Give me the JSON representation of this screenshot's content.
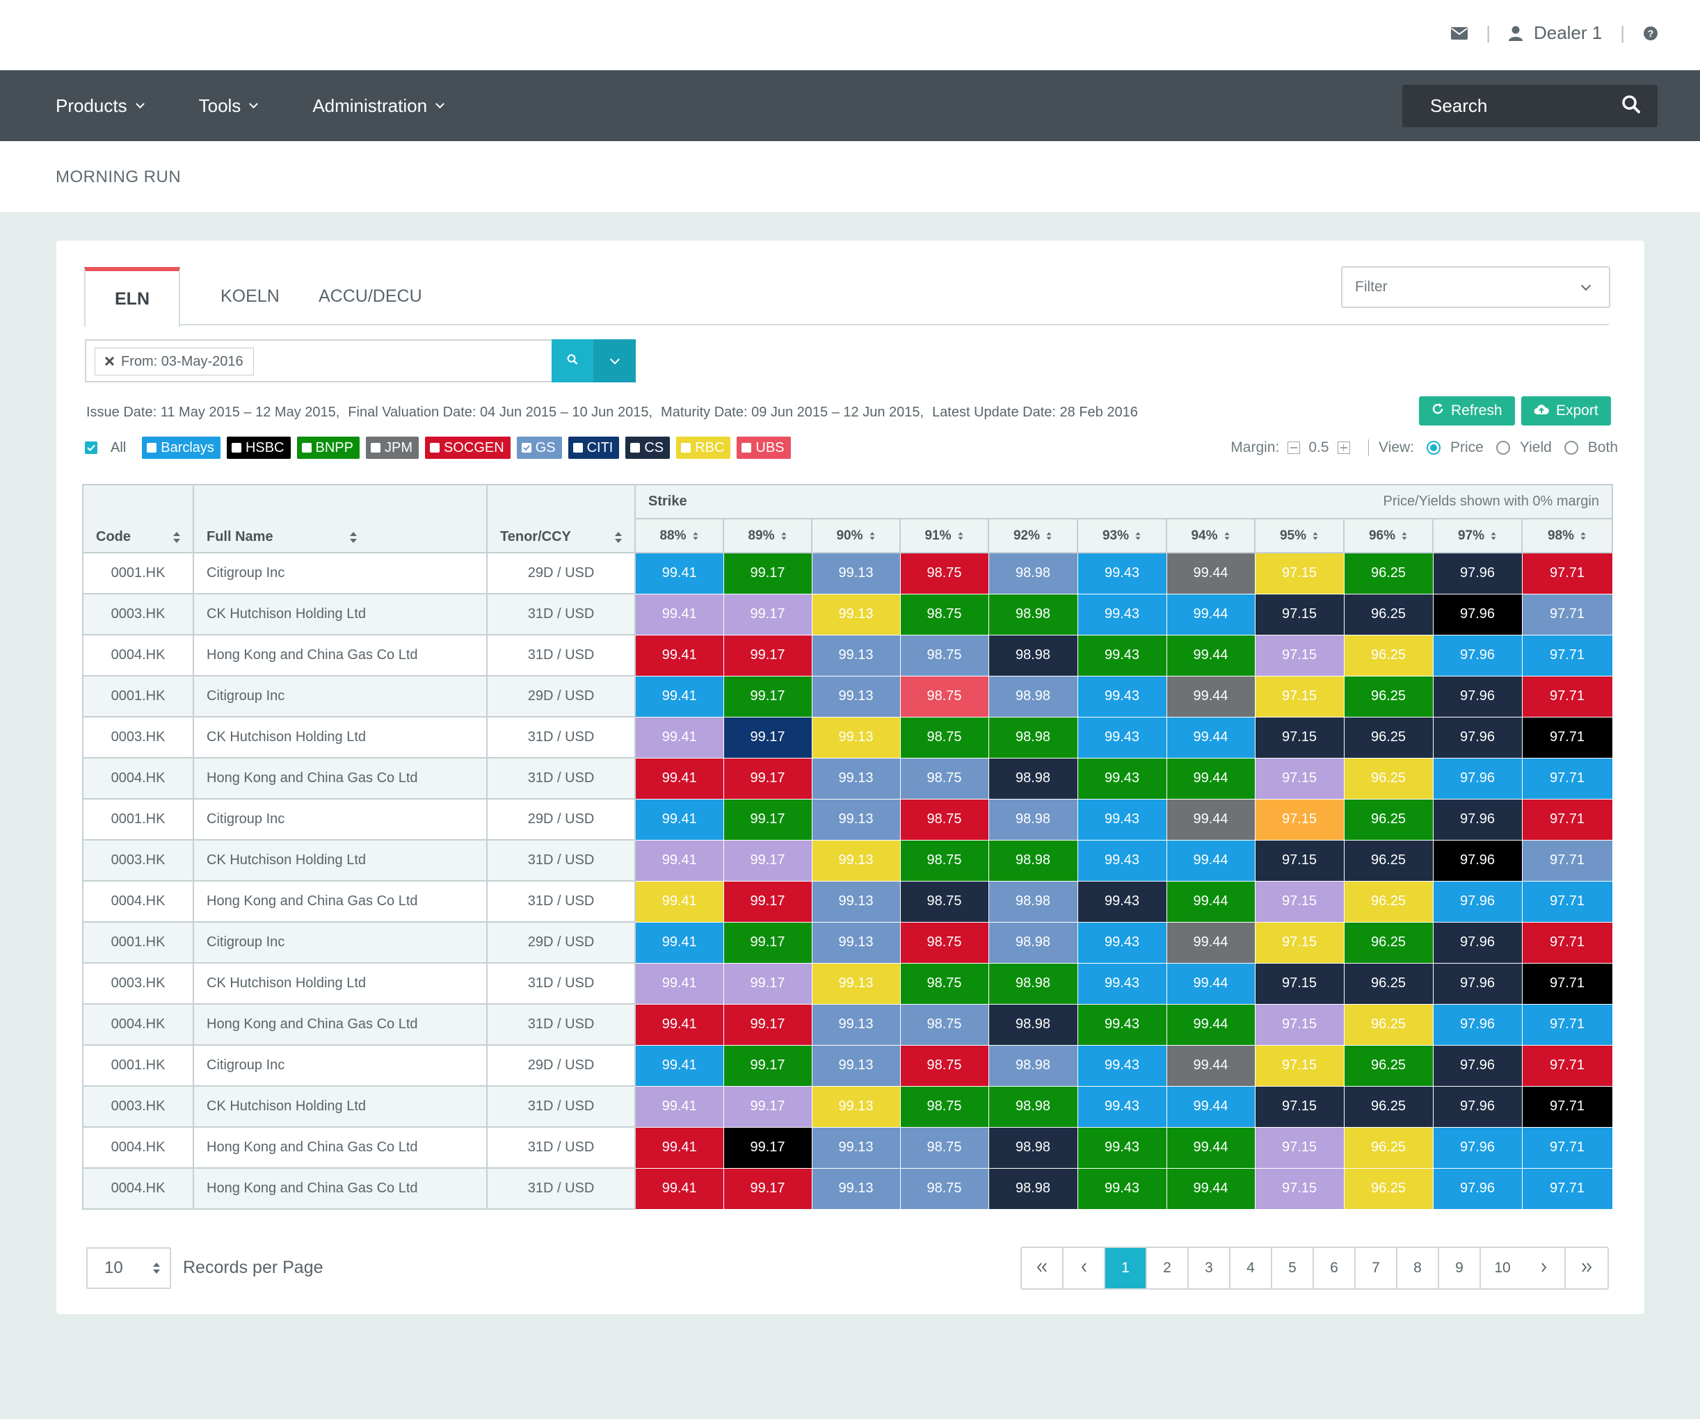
{
  "topbar": {
    "user_name": "Dealer 1",
    "icons": [
      "envelope-icon",
      "user-icon",
      "help-circle-icon"
    ]
  },
  "nav": {
    "menu": [
      {
        "label": "Products"
      },
      {
        "label": "Tools"
      },
      {
        "label": "Administration"
      }
    ],
    "search_placeholder": "Search"
  },
  "page": {
    "title": "MORNING RUN"
  },
  "tabs": [
    "ELN",
    "KOELN",
    "ACCU/DECU"
  ],
  "active_tab": "ELN",
  "filter": {
    "placeholder": "Filter"
  },
  "query": {
    "token": "From: 03-May-2016"
  },
  "dates": [
    "Issue Date: 11 May 2015 – 12 May 2015,",
    "Final Valuation Date: 04 Jun 2015 – 10 Jun 2015,",
    "Maturity Date: 09 Jun 2015 – 12 Jun 2015,",
    "Latest Update Date: 28 Feb 2016"
  ],
  "actions": {
    "refresh": "Refresh",
    "export": "Export"
  },
  "legend": {
    "all_label": "All",
    "banks": [
      {
        "name": "Barclays",
        "color": "#1b9ee3",
        "checked": false
      },
      {
        "name": "HSBC",
        "color": "#000000",
        "checked": false
      },
      {
        "name": "BNPP",
        "color": "#0b8f0b",
        "checked": false
      },
      {
        "name": "JPM",
        "color": "#6e7275",
        "checked": false
      },
      {
        "name": "SOCGEN",
        "color": "#d1102a",
        "checked": false
      },
      {
        "name": "GS",
        "color": "#6e97c8",
        "checked": true
      },
      {
        "name": "CITI",
        "color": "#0e3670",
        "checked": false
      },
      {
        "name": "CS",
        "color": "#1e2d44",
        "checked": false
      },
      {
        "name": "RBC",
        "color": "#ecd733",
        "checked": false
      },
      {
        "name": "UBS",
        "color": "#ea5060",
        "checked": false
      }
    ]
  },
  "view_controls": {
    "margin_label": "Margin:",
    "margin_value": "0.5",
    "view_label": "View:",
    "options": [
      "Price",
      "Yield",
      "Both"
    ],
    "selected": "Price"
  },
  "table": {
    "headers": {
      "code": "Code",
      "full_name": "Full Name",
      "tenor": "Tenor/CCY",
      "strike": "Strike",
      "note": "Price/Yields shown with 0% margin"
    },
    "strikes": [
      "88%",
      "89%",
      "90%",
      "91%",
      "92%",
      "93%",
      "94%",
      "95%",
      "96%",
      "97%",
      "98%"
    ],
    "values": [
      "99.41",
      "99.17",
      "99.13",
      "98.75",
      "98.98",
      "99.43",
      "99.44",
      "97.15",
      "96.25",
      "97.96",
      "97.71"
    ],
    "palette": {
      "a": "#1b9ee3",
      "g": "#0b8f0b",
      "s": "#7096c7",
      "r": "#d1102a",
      "d": "#6e7275",
      "y": "#ecd733",
      "n": "#1e2d44",
      "l": "#b6a2dc",
      "k": "#000000",
      "c": "#0e3670",
      "p": "#ea5060",
      "o": "#fbae3c"
    },
    "rows": [
      {
        "code": "0001.HK",
        "name": "Citigroup Inc",
        "tenor": "29D / USD",
        "colors": "agsrsadyg nr"
      },
      {
        "code": "0003.HK",
        "name": "CK Hutchison Holding Ltd",
        "tenor": "31D / USD",
        "colors": "llygga annk"
      },
      {
        "code": "0004.HK",
        "name": "Hong Kong and China Gas Co Ltd",
        "tenor": "31D / USD",
        "colors": "rrssngglyaa"
      },
      {
        "code": "0001.HK",
        "name": "Citigroup Inc",
        "tenor": "29D / USD",
        "colors": "agsps adygnr"
      },
      {
        "code": "0003.HK",
        "name": "CK Hutchison Holding Ltd",
        "tenor": "31D / USD",
        "colors": "lcyggaannnk"
      },
      {
        "code": "0004.HK",
        "name": "Hong Kong and China Gas Co Ltd",
        "tenor": "31D / USD",
        "colors": "rrssngglyaa"
      },
      {
        "code": "0001.HK",
        "name": "Citigroup Inc",
        "tenor": "29D / USD",
        "colors": "agsrsadognr"
      },
      {
        "code": "0003.HK",
        "name": "CK Hutchison Holding Ltd",
        "tenor": "31D / USD",
        "colors": "llygga annk"
      },
      {
        "code": "0004.HK",
        "name": "Hong Kong and China Gas Co Ltd",
        "tenor": "31D / USD",
        "colors": "yrsnsngl yaa"
      },
      {
        "code": "0001.HK",
        "name": "Citigroup Inc",
        "tenor": "29D / USD",
        "colors": "agsrsadygnr"
      },
      {
        "code": "0003.HK",
        "name": "CK Hutchison Holding Ltd",
        "tenor": "31D / USD",
        "colors": "llyggaannnk"
      },
      {
        "code": "0004.HK",
        "name": "Hong Kong and China Gas Co Ltd",
        "tenor": "31D / USD",
        "colors": "rrssngglyaa"
      },
      {
        "code": "0001.HK",
        "name": "Citigroup Inc",
        "tenor": "29D / USD",
        "colors": "agsrsadygnr"
      },
      {
        "code": "0003.HK",
        "name": "CK Hutchison Holding Ltd",
        "tenor": "31D / USD",
        "colors": "llyggaannnk"
      },
      {
        "code": "0004.HK",
        "name": "Hong Kong and China Gas Co Ltd",
        "tenor": "31D / USD",
        "colors": "rkssngglyaa"
      },
      {
        "code": "0004.HK",
        "name": "Hong Kong and China Gas Co Ltd",
        "tenor": "31D / USD",
        "colors": "rrssngglyaa"
      }
    ]
  },
  "pagination": {
    "per_page_value": "10",
    "per_page_label": "Records per Page",
    "pages": [
      "1",
      "2",
      "3",
      "4",
      "5",
      "6",
      "7",
      "8",
      "9",
      "10"
    ],
    "current": "1"
  }
}
